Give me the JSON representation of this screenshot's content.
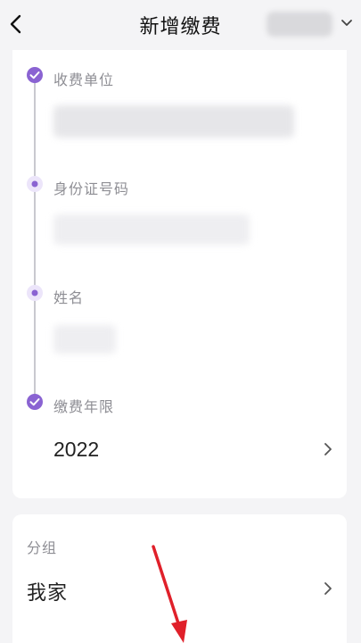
{
  "header": {
    "title": "新增缴费",
    "back_icon": "chevron-left-icon",
    "account_icon": "chevron-down-icon"
  },
  "form": {
    "steps": [
      {
        "label": "收费单位",
        "state": "completed"
      },
      {
        "label": "身份证号码",
        "state": "pending"
      },
      {
        "label": "姓名",
        "state": "pending"
      },
      {
        "label": "缴费年限",
        "state": "completed",
        "value": "2022"
      }
    ]
  },
  "group": {
    "label": "分组",
    "value": "我家"
  },
  "colors": {
    "accent": "#8a63d2",
    "accent_light": "#ece5fa",
    "annotation": "#e0202a"
  }
}
